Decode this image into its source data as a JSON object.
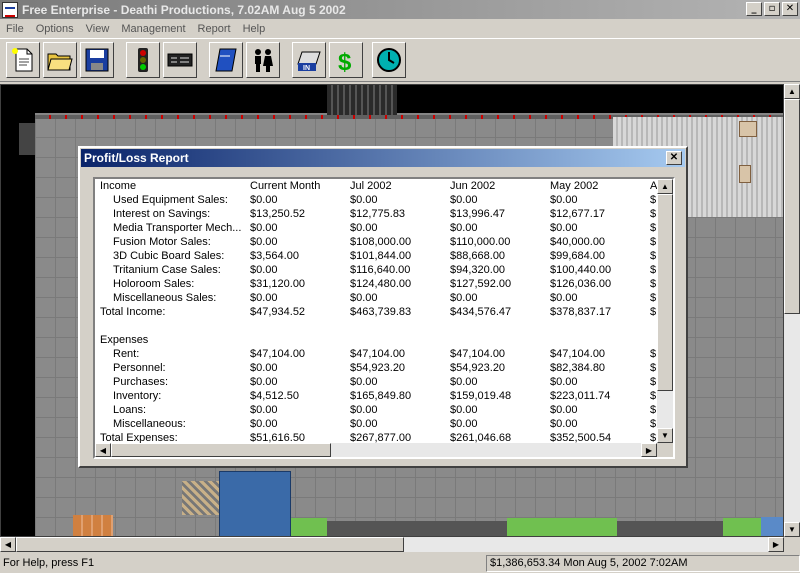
{
  "window": {
    "title": "Free Enterprise - Deathi Productions, 7.02AM Aug 5 2002",
    "minimize": "_",
    "maximize": "▫",
    "close": "✕"
  },
  "menu": [
    "File",
    "Options",
    "View",
    "Management",
    "Report",
    "Help"
  ],
  "toolbar": [
    {
      "name": "new-document-icon"
    },
    {
      "name": "open-folder-icon"
    },
    {
      "name": "save-disk-icon"
    },
    {
      "name": "traffic-light-icon"
    },
    {
      "name": "device-panel-icon"
    },
    {
      "name": "book-icon"
    },
    {
      "name": "people-icon"
    },
    {
      "name": "in-tray-icon"
    },
    {
      "name": "dollar-icon"
    },
    {
      "name": "clock-icon"
    }
  ],
  "dialog": {
    "title": "Profit/Loss Report",
    "close": "✕",
    "columns": [
      "Income",
      "Current Month",
      "Jul 2002",
      "Jun 2002",
      "May 2002",
      "A"
    ],
    "rows": [
      {
        "label": "Used Equipment Sales:",
        "indent": true,
        "values": [
          "$0.00",
          "$0.00",
          "$0.00",
          "$0.00",
          "$"
        ]
      },
      {
        "label": "Interest on Savings:",
        "indent": true,
        "values": [
          "$13,250.52",
          "$12,775.83",
          "$13,996.47",
          "$12,677.17",
          "$"
        ]
      },
      {
        "label": "Media Transporter Mech...",
        "indent": true,
        "values": [
          "$0.00",
          "$0.00",
          "$0.00",
          "$0.00",
          "$"
        ]
      },
      {
        "label": "Fusion Motor Sales:",
        "indent": true,
        "values": [
          "$0.00",
          "$108,000.00",
          "$110,000.00",
          "$40,000.00",
          "$"
        ]
      },
      {
        "label": "3D Cubic Board Sales:",
        "indent": true,
        "values": [
          "$3,564.00",
          "$101,844.00",
          "$88,668.00",
          "$99,684.00",
          "$"
        ]
      },
      {
        "label": "Tritanium Case Sales:",
        "indent": true,
        "values": [
          "$0.00",
          "$116,640.00",
          "$94,320.00",
          "$100,440.00",
          "$"
        ]
      },
      {
        "label": "Holoroom Sales:",
        "indent": true,
        "values": [
          "$31,120.00",
          "$124,480.00",
          "$127,592.00",
          "$126,036.00",
          "$"
        ]
      },
      {
        "label": "Miscellaneous Sales:",
        "indent": true,
        "values": [
          "$0.00",
          "$0.00",
          "$0.00",
          "$0.00",
          "$"
        ]
      },
      {
        "label": "Total Income:",
        "indent": false,
        "values": [
          "$47,934.52",
          "$463,739.83",
          "$434,576.47",
          "$378,837.17",
          "$"
        ]
      },
      {
        "label": "",
        "indent": false,
        "values": [
          "",
          "",
          "",
          "",
          ""
        ]
      },
      {
        "label": "Expenses",
        "indent": false,
        "values": [
          "",
          "",
          "",
          "",
          ""
        ]
      },
      {
        "label": "Rent:",
        "indent": true,
        "values": [
          "$47,104.00",
          "$47,104.00",
          "$47,104.00",
          "$47,104.00",
          "$"
        ]
      },
      {
        "label": "Personnel:",
        "indent": true,
        "values": [
          "$0.00",
          "$54,923.20",
          "$54,923.20",
          "$82,384.80",
          "$"
        ]
      },
      {
        "label": "Purchases:",
        "indent": true,
        "values": [
          "$0.00",
          "$0.00",
          "$0.00",
          "$0.00",
          "$"
        ]
      },
      {
        "label": "Inventory:",
        "indent": true,
        "values": [
          "$4,512.50",
          "$165,849.80",
          "$159,019.48",
          "$223,011.74",
          "$"
        ]
      },
      {
        "label": "Loans:",
        "indent": true,
        "values": [
          "$0.00",
          "$0.00",
          "$0.00",
          "$0.00",
          "$"
        ]
      },
      {
        "label": "Miscellaneous:",
        "indent": true,
        "values": [
          "$0.00",
          "$0.00",
          "$0.00",
          "$0.00",
          "$"
        ]
      },
      {
        "label": "Total Expenses:",
        "indent": false,
        "values": [
          "$51,616.50",
          "$267,877.00",
          "$261,046.68",
          "$352,500.54",
          "$"
        ]
      }
    ]
  },
  "status": {
    "help": "For Help, press F1",
    "info": "$1,386,653.34  Mon Aug 5, 2002  7:02AM"
  },
  "scroll": {
    "up": "▲",
    "down": "▼",
    "left": "◀",
    "right": "▶"
  },
  "colors": {
    "dialog_title": "#0a246a",
    "window_title": "#7a7a7a",
    "floor": "#8a8a8a",
    "wall": "#000000"
  }
}
